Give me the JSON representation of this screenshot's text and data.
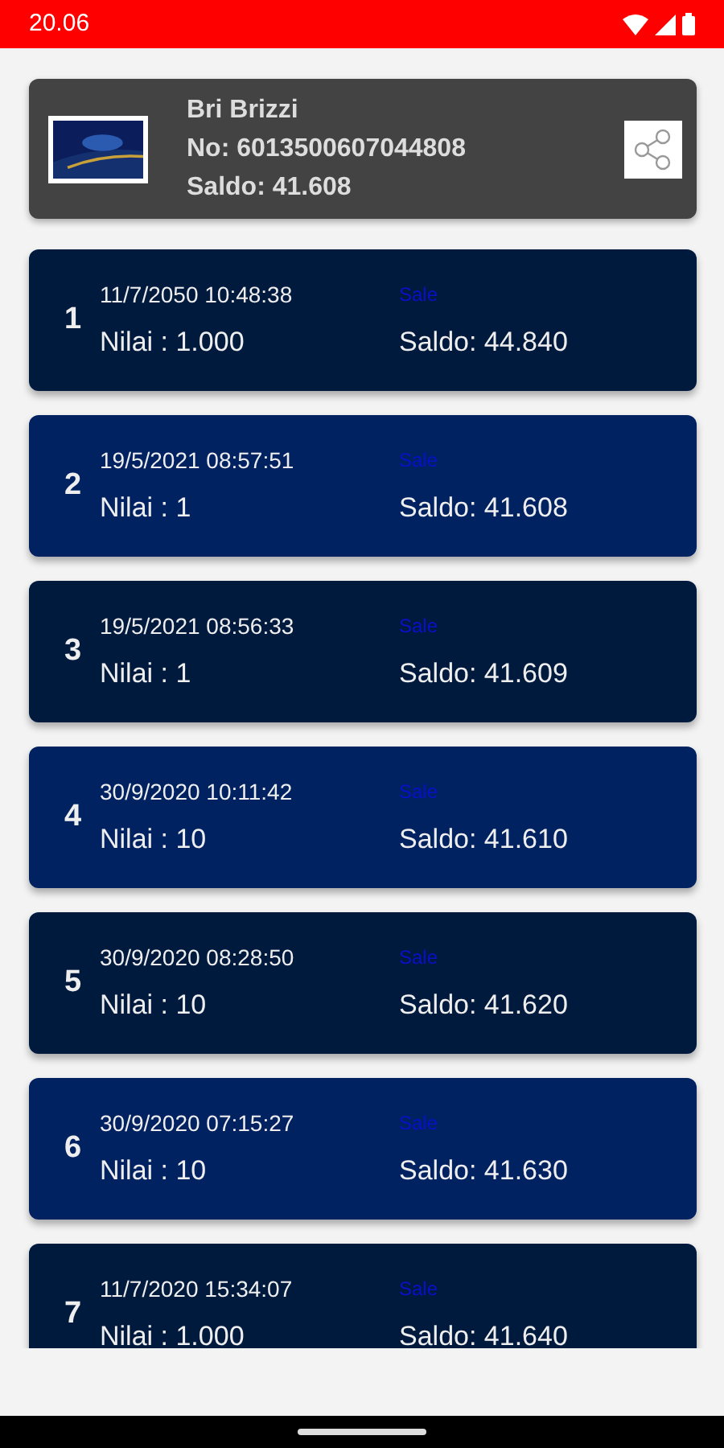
{
  "status_bar": {
    "time": "20.06"
  },
  "card": {
    "name": "Bri Brizzi",
    "number": "No: 6013500607044808",
    "balance": "Saldo: 41.608"
  },
  "transactions": [
    {
      "index": "1",
      "datetime": "11/7/2050 10:48:38",
      "type": "Sale",
      "amount": "Nilai : 1.000",
      "balance": "Saldo: 44.840"
    },
    {
      "index": "2",
      "datetime": "19/5/2021 08:57:51",
      "type": "Sale",
      "amount": "Nilai : 1",
      "balance": "Saldo: 41.608"
    },
    {
      "index": "3",
      "datetime": "19/5/2021 08:56:33",
      "type": "Sale",
      "amount": "Nilai : 1",
      "balance": "Saldo: 41.609"
    },
    {
      "index": "4",
      "datetime": "30/9/2020 10:11:42",
      "type": "Sale",
      "amount": "Nilai : 10",
      "balance": "Saldo: 41.610"
    },
    {
      "index": "5",
      "datetime": "30/9/2020 08:28:50",
      "type": "Sale",
      "amount": "Nilai : 10",
      "balance": "Saldo: 41.620"
    },
    {
      "index": "6",
      "datetime": "30/9/2020 07:15:27",
      "type": "Sale",
      "amount": "Nilai : 10",
      "balance": "Saldo: 41.630"
    },
    {
      "index": "7",
      "datetime": "11/7/2020 15:34:07",
      "type": "Sale",
      "amount": "Nilai : 1.000",
      "balance": "Saldo: 41.640"
    }
  ]
}
